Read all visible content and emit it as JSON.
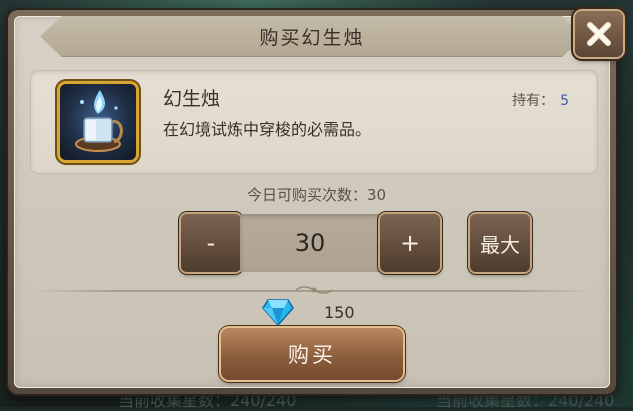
{
  "background": {
    "bottom_left_text": "当前收集星数：240/240",
    "bottom_right_text": "当前收集星数：240/240"
  },
  "dialog": {
    "title": "购买幻生烛",
    "close_icon": "close-x-icon"
  },
  "item": {
    "icon": "candle-item-icon",
    "name": "幻生烛",
    "description": "在幻境试炼中穿梭的必需品。",
    "owned_label": "持有：",
    "owned_value": "5"
  },
  "purchase": {
    "daily_limit_text": "今日可购买次数：30",
    "quantity": "30",
    "minus_label": "-",
    "plus_label": "+",
    "max_label": "最大",
    "currency_icon": "diamond-gem-icon",
    "price": "150",
    "buy_label": "购买"
  },
  "colors": {
    "owned_value": "#3c59b2",
    "frame_gold": "#d6a630",
    "button_brown": "#8d5e3e"
  }
}
